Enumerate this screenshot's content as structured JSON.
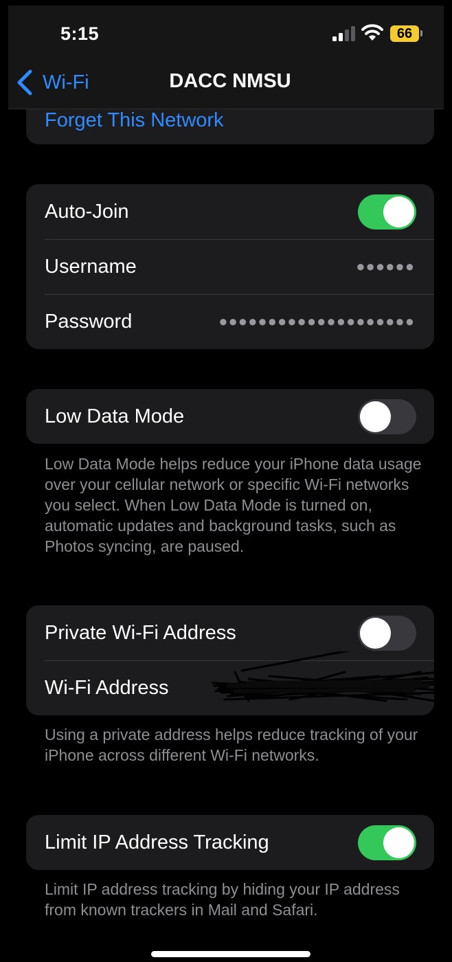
{
  "status_bar": {
    "time": "5:15",
    "battery": "66",
    "battery_color": "#f4cc2f"
  },
  "nav": {
    "back_label": "Wi-Fi",
    "title": "DACC NMSU"
  },
  "forget_network": {
    "label": "Forget This Network"
  },
  "credentials_group": {
    "auto_join": {
      "label": "Auto-Join",
      "on": true
    },
    "username": {
      "label": "Username",
      "value": "●●●●●●"
    },
    "password": {
      "label": "Password",
      "value": "●●●●●●●●●●●●●●●●●●●●"
    }
  },
  "low_data_mode": {
    "label": "Low Data Mode",
    "on": false,
    "footnote": "Low Data Mode helps reduce your iPhone data usage over your cellular network or specific Wi-Fi networks you select. When Low Data Mode is turned on, automatic updates and background tasks, such as Photos syncing, are paused."
  },
  "private_address_group": {
    "private_address": {
      "label": "Private Wi-Fi Address",
      "on": false
    },
    "wifi_address": {
      "label": "Wi-Fi Address"
    },
    "footnote": "Using a private address helps reduce tracking of your iPhone across different Wi-Fi networks."
  },
  "limit_ip": {
    "label": "Limit IP Address Tracking",
    "on": true,
    "footnote": "Limit IP address tracking by hiding your IP address from known trackers in Mail and Safari."
  },
  "colors": {
    "accent": "#2f8cff",
    "toggle_on": "#34c759",
    "toggle_off": "#39393d",
    "card": "#1c1c1e"
  },
  "icons": [
    "cellular-signal-icon",
    "wifi-icon",
    "battery-icon",
    "chevron-left-icon"
  ]
}
